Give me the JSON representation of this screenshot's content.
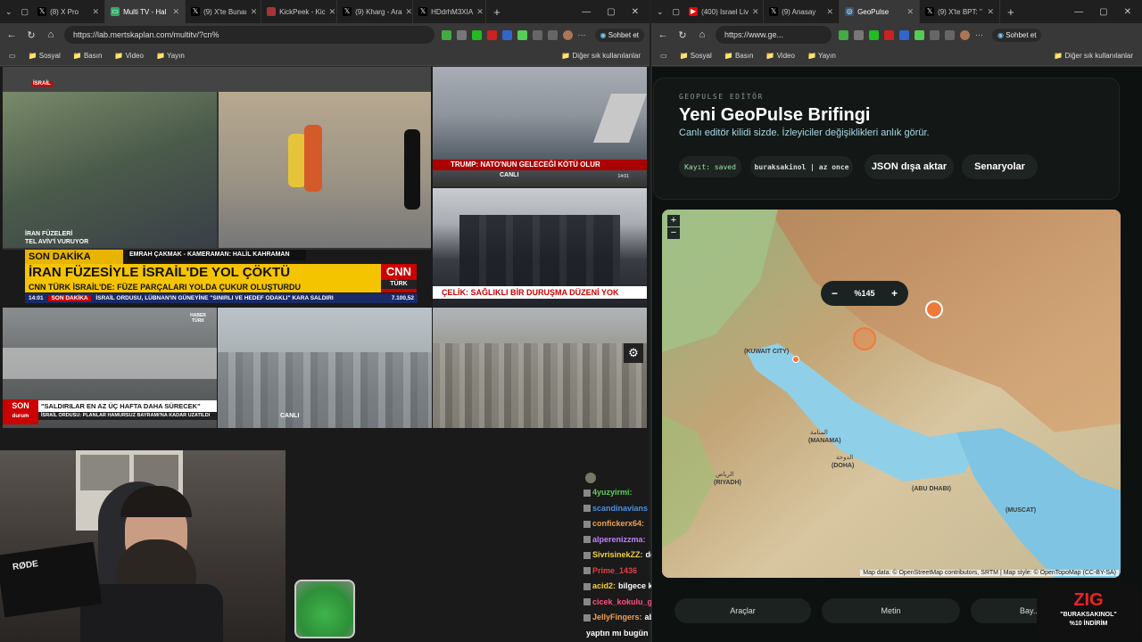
{
  "left_window": {
    "tabs": [
      {
        "label": "(8) X Pro",
        "icon": "x-logo-icon"
      },
      {
        "label": "Multi TV - Hal",
        "icon": "tv-icon"
      },
      {
        "label": "(9) X'te Bunaı",
        "icon": "x-logo-icon"
      },
      {
        "label": "KickPeek - Kic",
        "icon": "kick-icon"
      },
      {
        "label": "(9) Kharg - Ara",
        "icon": "x-logo-icon"
      },
      {
        "label": "HDdrhM3XIA",
        "icon": "x-logo-icon"
      }
    ],
    "url": "https://lab.mertskaplan.com/multitv/?cn%",
    "chat_button": "Sohbet et",
    "bookmarks": [
      "Sosyal",
      "Basın",
      "Video",
      "Yayın"
    ],
    "bookmarks_other": "Diğer sık kullanılanlar"
  },
  "right_window": {
    "tabs": [
      {
        "label": "(400) Israel Liv",
        "icon": "youtube-icon"
      },
      {
        "label": "(9) Anasay",
        "icon": "x-logo-icon"
      },
      {
        "label": "GeoPulse",
        "icon": "globe-icon"
      },
      {
        "label": "(9) X'te BPT: \"",
        "icon": "x-logo-icon"
      }
    ],
    "url": "https://www.ge...",
    "chat_button": "Sohbet et",
    "bookmarks": [
      "Sosyal",
      "Basın",
      "Video",
      "Yayın"
    ],
    "bookmarks_other": "Diğer sık kullanılanlar"
  },
  "tv": {
    "tile1": {
      "tag": "İSRAİL",
      "caption1": "İRAN FÜZELERİ",
      "caption2": "TEL AVİV'İ VURUYOR"
    },
    "cnn": {
      "credits": "EMRAH ÇAKMAK - KAMERAMAN: HALİL KAHRAMAN",
      "son_dakika": "SON DAKİKA",
      "headline": "İRAN FÜZESİYLE İSRAİL'DE YOL ÇÖKTÜ",
      "subline": "CNN TÜRK İSRAİL'DE: FÜZE PARÇALARI YOLDA ÇUKUR OLUŞTURDU",
      "time": "14:01",
      "ticker_tag": "SON DAKİKA",
      "ticker": "İSRAİL ORDUSU, LÜBNAN'IN GÜNEYİNE \"SINIRLI VE HEDEF ODAKLI\" KARA SALDIRI",
      "index": "7.100,52",
      "logo_top": "CNN",
      "logo_bottom": "TÜRK"
    },
    "tile_trump": {
      "live": "CANLI",
      "headline": "TRUMP: NATO'NUN GELECEĞİ KÖTÜ OLUR",
      "time": "14:01"
    },
    "tile_celik": {
      "headline": "ÇELİK: SAĞLIKLI BİR DURUŞMA DÜZENİ YOK"
    },
    "tile_haber": {
      "son": "SON",
      "durum": "durum",
      "headline": "\"SALDIRILAR EN AZ ÜÇ HAFTA DAHA SÜRECEK\"",
      "sub": "İSRAİL ORDUSU: PLANLAR HAMURSUZ BAYRAMI'NA KADAR UZATILDI",
      "logo": "HABER TÜRK"
    },
    "tile_city": {
      "live": "CANLI"
    }
  },
  "chat": [
    {
      "user": "4yuzyirmi:",
      "text": "",
      "color": "#5ad05a"
    },
    {
      "user": "scandinavians",
      "text": "",
      "color": "#4a90e2"
    },
    {
      "user": "confickerx64:",
      "text": "",
      "color": "#f0a050"
    },
    {
      "user": "alperenizzma:",
      "text": "",
      "color": "#c080ff"
    },
    {
      "user": "SivrisinekZZ:",
      "text": "dövüşmen güzum",
      "color": "#f5d040"
    },
    {
      "user": "Prime_1436",
      "text": "",
      "color": "#e04040"
    },
    {
      "user": "acid2:",
      "text": "bilgece konusmus china",
      "color": "#f5d040"
    },
    {
      "user": "cicek_kokulu_gotik:",
      "text": "",
      "color": "#ff5080"
    },
    {
      "user": "JellyFingers:",
      "text": "ab avakadolu tost",
      "color": "#f0a050"
    },
    {
      "user": "",
      "text": "yaptın mı bugün",
      "color": "#ffffff"
    }
  ],
  "webcam": {
    "mic_brand": "RØDE"
  },
  "geopulse": {
    "eyebrow": "GEOPULSE EDİTÖR",
    "title": "Yeni GeoPulse Brifingi",
    "subtitle": "Canlı editör kilidi sizde. İzleyiciler değişiklikleri anlık görür.",
    "save_status": "Kayıt: saved",
    "editor_user": "buraksakinol | az once",
    "export_button": "JSON dışa aktar",
    "scenarios_button": "Senaryolar",
    "zoom_level": "%145",
    "map_attribution": "Map data: © OpenStreetMap contributors, SRTM | Map style: © OpenTopoMap (CC-BY-SA)",
    "map_labels": [
      "(KUWAIT CITY)",
      "(MANAMA)",
      "(DOHA)",
      "(RIYADH)",
      "(ABU DHABI)",
      "(MUSCAT)",
      "الرياض",
      "الدوحة",
      "المنامة"
    ],
    "bottom_tools": [
      "Araçlar",
      "Metin",
      "Bay..."
    ]
  },
  "promo": {
    "logo": "ZIG",
    "line1": "\"BURAKSAKINOL\"",
    "line2": "%10 İNDİRİM"
  }
}
